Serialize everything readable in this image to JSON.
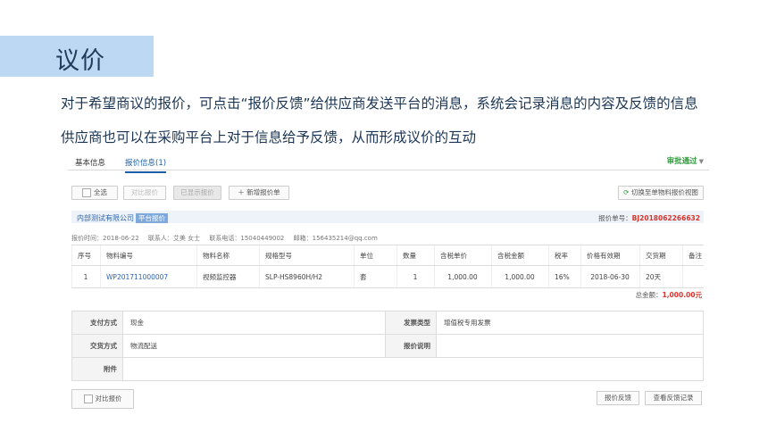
{
  "slide": {
    "title": "议价",
    "line1": "对于希望商议的报价，可点击“报价反馈”给供应商发送平台的消息，系统会记录消息的内容及反馈的信息",
    "line2": "供应商也可以在采购平台上对于信息给予反馈，从而形成议价的互动"
  },
  "tabs": {
    "basic": "基本信息",
    "quote": "报价信息(1)",
    "status": "审批通过"
  },
  "toolbar": {
    "select_all": "全选",
    "compare": "对比报价",
    "show_quote": "已显示报价",
    "add_quote": "新增报价单",
    "switch_view": "切换至单物料报价视图"
  },
  "supplier": {
    "name": "内部测试有限公司",
    "tag": "平台报价",
    "quote_no_label": "报价单号：",
    "quote_no": "BJ2018062266632"
  },
  "meta": {
    "quote_time": "报价时间：2018-06-22",
    "contact": "联系人：艾美 女士",
    "phone": "联系电话：15040449002",
    "email": "邮箱：156435214@qq.com"
  },
  "table": {
    "headers": [
      "序号",
      "物料编号",
      "物料名称",
      "规格型号",
      "单位",
      "数量",
      "含税单价",
      "含税金额",
      "税率",
      "价格有效期",
      "交货期",
      "备注"
    ],
    "rows": [
      [
        "1",
        "WP201711000007",
        "视频监控器",
        "SLP-HS8960H/H2",
        "套",
        "1",
        "1,000.00",
        "1,000.00",
        "16%",
        "2018-06-30",
        "20天",
        ""
      ]
    ]
  },
  "total": {
    "label": "总金额：",
    "value": "1,000.00元"
  },
  "details": {
    "payment_label": "支付方式",
    "payment": "现金",
    "invoice_label": "发票类型",
    "invoice": "增值税专用发票",
    "delivery_label": "交货方式",
    "delivery": "物流配送",
    "note_label": "报价说明",
    "note": "",
    "attach_label": "附件",
    "attach": ""
  },
  "footer": {
    "compare": "对比报价",
    "feedback": "报价反馈",
    "view_feedback": "查看反馈记录"
  },
  "colors": {
    "accent": "#1b5fa8",
    "approved": "#2e9a3a",
    "price_red": "#d9322b",
    "title_band": "#bcd8f2"
  }
}
